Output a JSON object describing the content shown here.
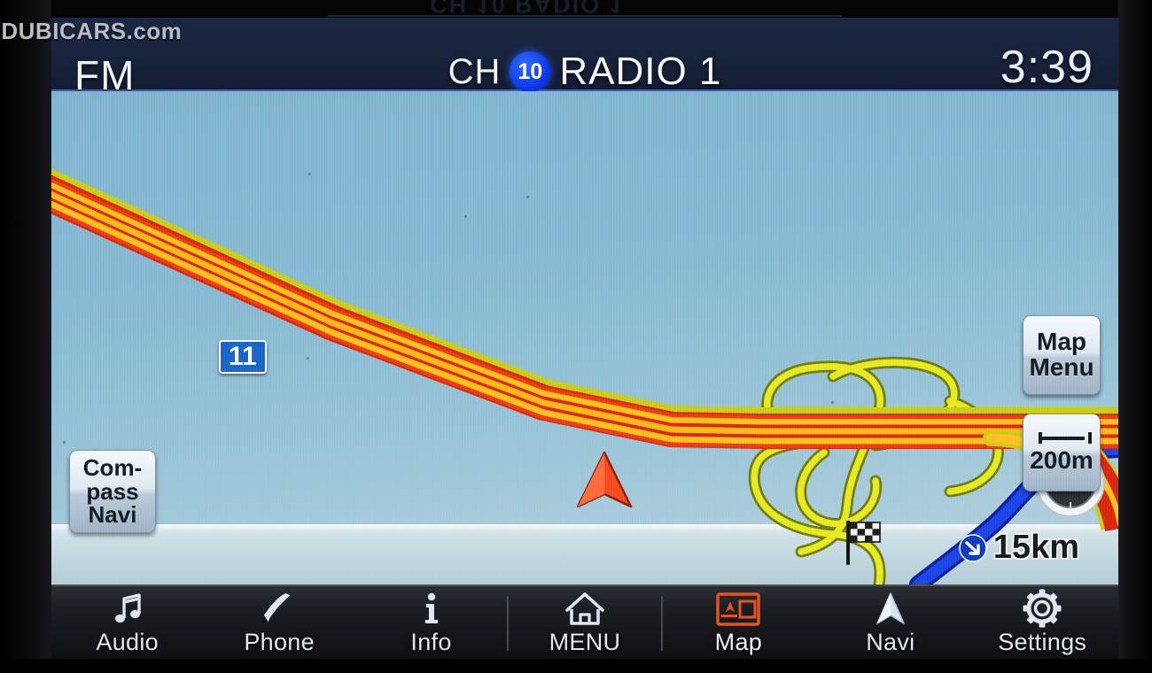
{
  "watermark": "© DUBICARS.com",
  "header": {
    "source_label": "FM",
    "ch_word": "CH",
    "ch_number": "10",
    "station_name": "RADIO 1",
    "clock": "3:39"
  },
  "map": {
    "map_menu_line1": "Map",
    "map_menu_line2": "Menu",
    "scale_value": "200m",
    "scale_icon": "ruler-icon",
    "compass_navi_line1": "Com-",
    "compass_navi_line2": "pass",
    "compass_navi_line3": "Navi",
    "road_shield_number": "11",
    "remaining_distance": "15km",
    "remaining_distance_icon": "route-arrow-icon",
    "vehicle_icon": "vehicle-position-arrow",
    "destination_icon": "checkered-flag-icon",
    "compass_icon": "compass-rose-icon",
    "colors": {
      "map_background": "#86b9d2",
      "highway_core": "#e8300c",
      "highway_lane": "#ffc21a",
      "ramp": "#e2e617",
      "route": "#1032d8",
      "shield_blue": "#1763c8",
      "vehicle_arrow": "#f24a1e",
      "accent_orange": "#e8541f"
    }
  },
  "navbar": {
    "items": [
      {
        "label": "Audio",
        "icon": "music-note-icon",
        "active": false
      },
      {
        "label": "Phone",
        "icon": "phone-handset-icon",
        "active": false
      },
      {
        "label": "Info",
        "icon": "info-i-icon",
        "active": false
      },
      {
        "label": "MENU",
        "icon": "home-icon",
        "active": false
      },
      {
        "label": "Map",
        "icon": "map-layout-icon",
        "active": true
      },
      {
        "label": "Navi",
        "icon": "navigation-arrow-icon",
        "active": false
      },
      {
        "label": "Settings",
        "icon": "gear-icon",
        "active": false
      }
    ]
  }
}
